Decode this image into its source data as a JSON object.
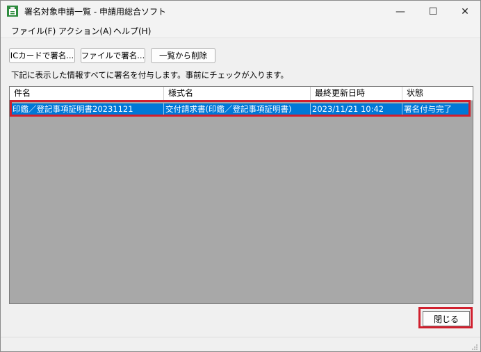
{
  "window": {
    "title": "署名対象申請一覧 - 申請用総合ソフト",
    "controls": {
      "minimize": "—",
      "maximize": "☐",
      "close": "✕"
    }
  },
  "menu": [
    "ファイル(F)",
    "アクション(A)",
    "ヘルプ(H)"
  ],
  "toolbar": {
    "ic_card_sign": "ICカードで署名...",
    "file_sign": "ファイルで署名...",
    "remove_from_list": "一覧から削除"
  },
  "info_text": "下記に表示した情報すべてに署名を付与します。事前にチェックが入ります。",
  "table": {
    "columns": [
      "件名",
      "様式名",
      "最終更新日時",
      "状態"
    ],
    "rows": [
      [
        "印鑑／登記事項証明書20231121",
        "交付請求書(印鑑／登記事項証明書)",
        "2023/11/21 10:42",
        "署名付与完了"
      ]
    ]
  },
  "close_button": "閉じる",
  "colors": {
    "selection": "#0078d7",
    "highlight_box": "#d0202e",
    "list_background": "#a8a8a8"
  }
}
